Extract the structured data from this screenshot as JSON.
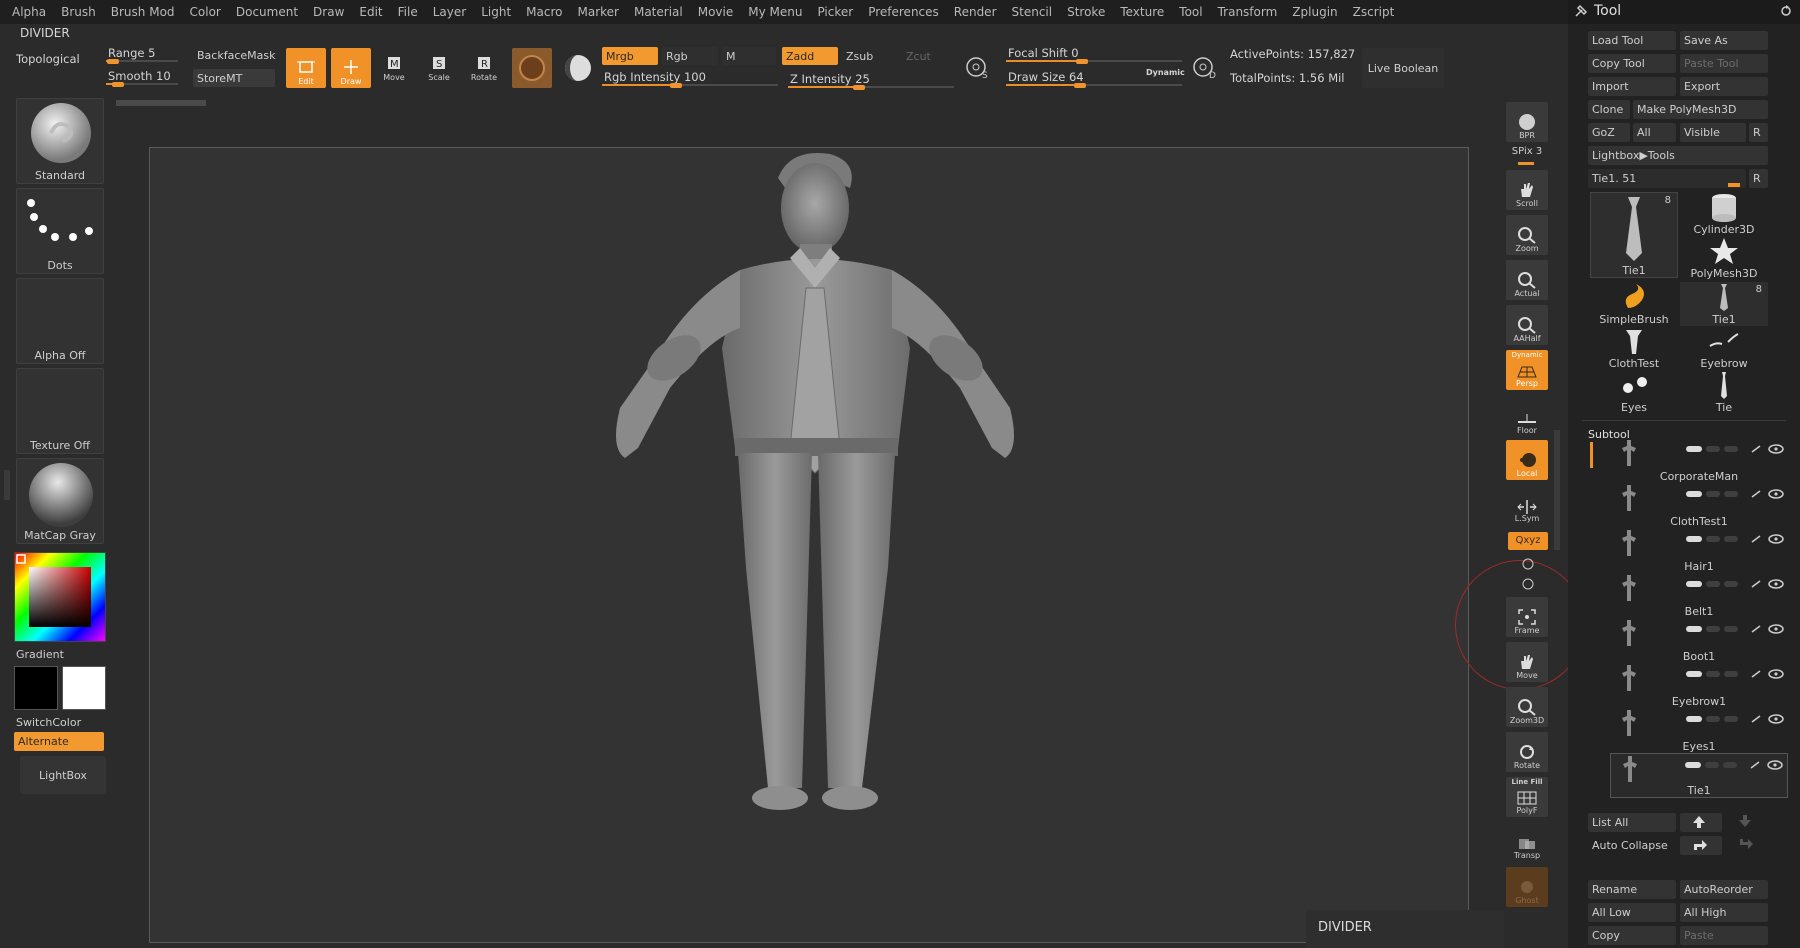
{
  "menu": [
    "Alpha",
    "Brush",
    "Brush Mod",
    "Color",
    "Document",
    "Draw",
    "Edit",
    "File",
    "Layer",
    "Light",
    "Macro",
    "Marker",
    "Material",
    "Movie",
    "My Menu",
    "Picker",
    "Preferences",
    "Render",
    "Stencil",
    "Stroke",
    "Texture",
    "Tool",
    "Transform",
    "Zplugin",
    "Zscript"
  ],
  "divider_top": "DIVIDER",
  "toolbar": {
    "topological": "Topological",
    "range": "Range 5",
    "smooth": "Smooth 10",
    "backface": "BackfaceMask",
    "storemt": "StoreMT",
    "edit": "Edit",
    "draw": "Draw",
    "move": "Move",
    "scale": "Scale",
    "rotate": "Rotate",
    "mrgb": "Mrgb",
    "rgb": "Rgb",
    "m": "M",
    "zadd": "Zadd",
    "zsub": "Zsub",
    "zcut": "Zcut",
    "rgb_intensity": "Rgb Intensity 100",
    "z_intensity": "Z Intensity 25",
    "focal_shift": "Focal Shift 0",
    "draw_size": "Draw Size 64",
    "dynamic": "Dynamic",
    "active_points": "ActivePoints: 157,827",
    "total_points": "TotalPoints: 1.56 Mil",
    "live_boolean": "Live Boolean",
    "rgb_intensity_value": 1.0,
    "z_intensity_value": 0.25,
    "focal_shift_value": 0.5,
    "draw_size_value": 0.42,
    "range_value": 0.1,
    "smooth_value": 0.16
  },
  "left": {
    "standard": "Standard",
    "dots": "Dots",
    "alpha_off": "Alpha Off",
    "texture_off": "Texture Off",
    "matcap": "MatCap Gray",
    "gradient": "Gradient",
    "switchcolor": "SwitchColor",
    "alternate": "Alternate",
    "lightbox": "LightBox"
  },
  "rightbar": {
    "bpr": "BPR",
    "spix": "SPix 3",
    "scroll": "Scroll",
    "zoom": "Zoom",
    "actual": "Actual",
    "aahalf": "AAHalf",
    "persp": "Persp",
    "dynamic": "Dynamic",
    "floor": "Floor",
    "local": "Local",
    "lsym": "L.Sym",
    "xyz": "Qxyz",
    "frame": "Frame",
    "move": "Move",
    "zoom3d": "Zoom3D",
    "rotate": "Rotate",
    "linefill": "Line Fill",
    "polyf": "PolyF",
    "transp": "Transp",
    "ghost": "Ghost"
  },
  "divider_bottom": "DIVIDER",
  "toolpanel": {
    "title": "Tool",
    "load_tool": "Load Tool",
    "save_as": "Save As",
    "copy_tool": "Copy Tool",
    "paste_tool": "Paste Tool",
    "import": "Import",
    "export": "Export",
    "clone": "Clone",
    "make_polymesh": "Make PolyMesh3D",
    "goz": "GoZ",
    "all": "All",
    "visible": "Visible",
    "r": "R",
    "lightbox_tools": "Lightbox▶Tools",
    "current_tool": "Tie1. 51",
    "tools": [
      {
        "label": "Tie1",
        "count": "8"
      },
      {
        "label": "Cylinder3D",
        "count": ""
      },
      {
        "label": "PolyMesh3D",
        "count": ""
      },
      {
        "label": "SimpleBrush",
        "count": ""
      },
      {
        "label": "Tie1",
        "count": "8"
      },
      {
        "label": "ClothTest",
        "count": ""
      },
      {
        "label": "Eyebrow",
        "count": ""
      },
      {
        "label": "Eyes",
        "count": ""
      },
      {
        "label": "Tie",
        "count": ""
      }
    ],
    "subtool_title": "Subtool",
    "subtools": [
      "CorporateMan",
      "ClothTest1",
      "Hair1",
      "Belt1",
      "Boot1",
      "Eyebrow1",
      "Eyes1",
      "Tie1"
    ],
    "list_all": "List All",
    "auto_collapse": "Auto Collapse",
    "rename": "Rename",
    "autoreorder": "AutoReorder",
    "all_low": "All Low",
    "all_high": "All High",
    "copy": "Copy",
    "paste": "Paste"
  }
}
